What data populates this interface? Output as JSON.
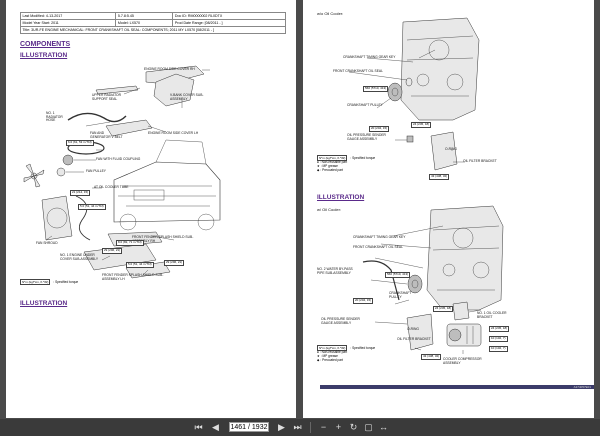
{
  "header_table": {
    "last_modified": "Last Modified: 4-13-2017",
    "version": "5.7.8:5.45",
    "doc_id": "Doc ID: RM0000002 RL0DTX",
    "model_year": "Model Year Start: 2011",
    "model": "Model: LX570",
    "prod_range": "Prod Date Range: [08/2011 - ]",
    "title": "Title: 3UR-FE ENGINE MECHANICAL: FRONT CRANKSHAFT OIL SEAL: COMPONENTS; 2011 MY LX570 [08/2011 - ]"
  },
  "left_page": {
    "components_heading": "COMPONENTS",
    "illustration_heading_1": "ILLUSTRATION",
    "illustration_heading_2": "ILLUSTRATION",
    "labels": [
      "ENGINE ROOM SIDE COVER RH",
      "UPPER RADIATOR SUPPORT SEAL",
      "V-BANK COVER SUB-ASSEMBLY",
      "NO. 1 RADIATOR HOSE",
      "ENGINE ROOM SIDE COVER LH",
      "FAN AND GENERATOR V BELT",
      "FAN WITH FLUID COUPLING",
      "FAN PULLEY",
      "AT OIL COOLER TUBE",
      "FAN SHROUD",
      "FRONT FENDER SPLASH SHIELD SUB-ASSEMBLY RH",
      "NO. 1 ENGINE UNDER COVER SUB-ASSEMBLY",
      "FRONT FENDER SPLASH SHIELD SUB-ASSEMBLY LH"
    ],
    "torques": [
      "6.0 (61, 53 in.*lbf)",
      "21 (214, 15)",
      "5.0 (51, 44 in.*lbf)",
      "8.0 (82, 71 in.*lbf)",
      "29 (296, 21)",
      "5.0 (51, 44 in.*lbf)",
      "29 (296, 21)"
    ],
    "legend_unit": "N*m (kgf*cm, ft.*lbf)",
    "legend_text": ": Specified torque"
  },
  "right_page": {
    "wo_cooler": "w/o Oil Cooler:",
    "w_cooler": "w/ Oil Cooler:",
    "illustration_heading": "ILLUSTRATION",
    "labels_top": [
      "CRANKSHAFT TIMING GEAR KEY",
      "FRONT CRANKSHAFT OIL SEAL",
      "CRANKSHAFT PULLEY",
      "OIL PRESSURE SENDER GAUGE ASSEMBLY",
      "O-RING",
      "OIL FILTER BRACKET"
    ],
    "labels_bottom": [
      "CRANKSHAFT TIMING GEAR KEY",
      "FRONT CRANKSHAFT OIL SEAL",
      "NO. 2 WATER BY-PASS PIPE SUB-ASSEMBLY",
      "CRANKSHAFT PULLEY",
      "OIL PRESSURE SENDER GAUGE ASSEMBLY",
      "O-RING",
      "OIL FILTER BRACKET",
      "NO. 1 OIL COOLER BRACKET",
      "COOLER COMPRESSOR ASSEMBLY"
    ],
    "torques_top": [
      "560 (5710, 413)",
      "24 (245, 18)",
      "20 (204, 15)",
      "43 (438, 32)"
    ],
    "torques_bottom": [
      "560 (5710, 413)",
      "20 (204, 15)",
      "24 (245, 18)",
      "43 (438, 32)",
      "24 (245, 18)",
      "10 (102, 7)",
      "10 (102, 7)"
    ],
    "legend_unit": "N*m (kgf*cm, ft.*lbf)",
    "legend_torque": ": Specified torque",
    "legend_nonreusable": ": Non-reusable part",
    "legend_mp": ": MP grease",
    "legend_precoated": ": Precoated part",
    "footer_code": "A174057E01"
  },
  "toolbar": {
    "current_page": "1461 / 1932",
    "icons": [
      "first-page-icon",
      "prev-page-icon",
      "next-page-icon",
      "last-page-icon",
      "zoom-out-icon",
      "zoom-in-icon",
      "rotate-icon",
      "fit-page-icon",
      "fit-width-icon"
    ]
  }
}
